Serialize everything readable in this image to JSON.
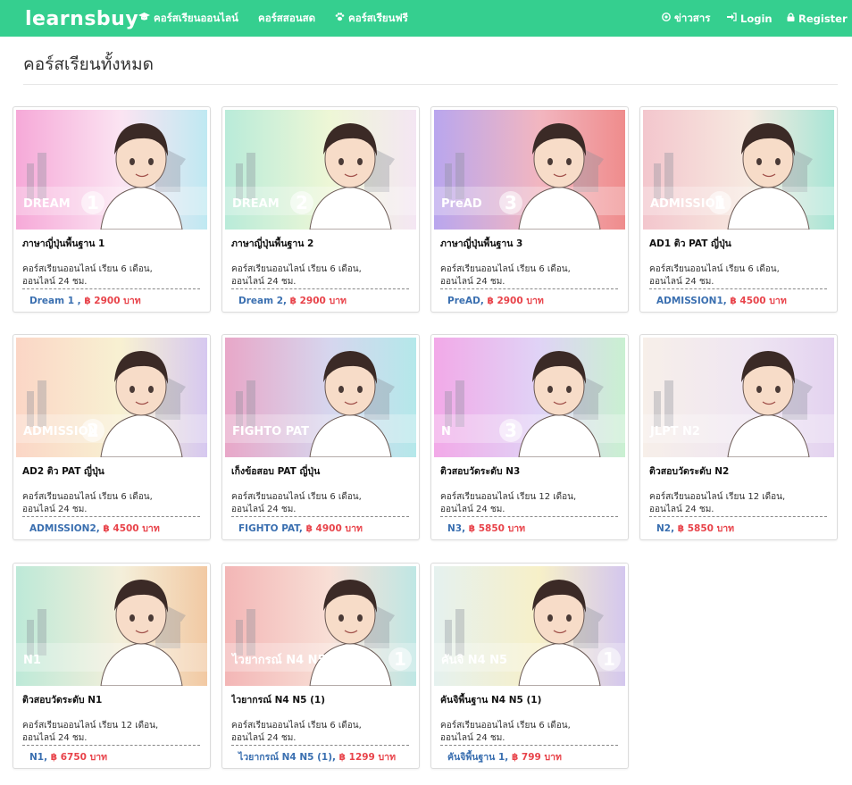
{
  "navbar": {
    "logo": "learnsbuy",
    "items": [
      {
        "label": "คอร์สเรียนออนไลน์",
        "icon": "graduation-cap-icon"
      },
      {
        "label": "คอร์สสอนสด",
        "icon": ""
      },
      {
        "label": "คอร์สเรียนฟรี",
        "icon": "paw-icon"
      }
    ],
    "right": [
      {
        "label": "ข่าวสาร",
        "icon": "news-icon"
      },
      {
        "label": "Login",
        "icon": "sign-in-icon"
      },
      {
        "label": "Register",
        "icon": "lock-icon"
      }
    ]
  },
  "page": {
    "title": "คอร์สเรียนทั้งหมด"
  },
  "courses": [
    {
      "title": "ภาษาญี่ปุ่นพื้นฐาน 1",
      "desc1": "คอร์สเรียนออนไลน์ เรียน 6 เดือน,",
      "desc2": "ออนไลน์ 24 ชม.",
      "code": "Dream 1 ,",
      "price": "฿ 2900 บาท",
      "badge": "DREAM",
      "num": "1",
      "colors": [
        "#f6a9d8",
        "#fbe4f2",
        "#bfe9f2"
      ]
    },
    {
      "title": "ภาษาญี่ปุ่นพื้นฐาน 2",
      "desc1": "คอร์สเรียนออนไลน์ เรียน 6 เดือน,",
      "desc2": "ออนไลน์ 24 ชม.",
      "code": "Dream 2,",
      "price": "฿ 2900 บาท",
      "badge": "DREAM",
      "num": "2",
      "colors": [
        "#b9ebd9",
        "#eef7d6",
        "#f4e6f3"
      ]
    },
    {
      "title": "ภาษาญี่ปุ่นพื้นฐาน 3",
      "desc1": "คอร์สเรียนออนไลน์ เรียน 6 เดือน,",
      "desc2": "ออนไลน์ 24 ชม.",
      "code": "PreAD,",
      "price": "฿ 2900 บาท",
      "badge": "PreAD",
      "num": "3",
      "colors": [
        "#b9a6ee",
        "#f2b6c0",
        "#ef8c8c"
      ]
    },
    {
      "title": "AD1 ติว PAT ญี่ปุ่น",
      "desc1": "คอร์สเรียนออนไลน์ เรียน 6 เดือน,",
      "desc2": "ออนไลน์ 24 ชม.",
      "code": "ADMISSION1,",
      "price": "฿ 4500 บาท",
      "badge": "ADMISSION",
      "num": "1",
      "colors": [
        "#f3c6cd",
        "#f7e9e0",
        "#a8e6d6"
      ]
    },
    {
      "title": "AD2 ติว PAT ญี่ปุ่น",
      "desc1": "คอร์สเรียนออนไลน์ เรียน 6 เดือน,",
      "desc2": "ออนไลน์ 24 ชม.",
      "code": "ADMISSION2,",
      "price": "฿ 4500 บาท",
      "badge": "ADMISSION",
      "num": "2",
      "colors": [
        "#fbd6c6",
        "#f8f1d2",
        "#d6c8f0"
      ]
    },
    {
      "title": "เก็งข้อสอบ PAT ญี่ปุ่น",
      "desc1": "คอร์สเรียนออนไลน์ เรียน 6 เดือน,",
      "desc2": "ออนไลน์ 24 ชม.",
      "code": "FIGHTO PAT,",
      "price": "฿ 4900 บาท",
      "badge": "FIGHTO PAT",
      "num": "",
      "colors": [
        "#e8a7c8",
        "#d6d6ee",
        "#b4e8ea"
      ]
    },
    {
      "title": "ติวสอบวัดระดับ N3",
      "desc1": "คอร์สเรียนออนไลน์ เรียน 12 เดือน,",
      "desc2": "ออนไลน์ 24 ชม.",
      "code": "N3,",
      "price": "฿ 5850 บาท",
      "badge": "N",
      "num": "3",
      "colors": [
        "#f2a9e8",
        "#e0d3f6",
        "#c9f0d1"
      ]
    },
    {
      "title": "ติวสอบวัดระดับ N2",
      "desc1": "คอร์สเรียนออนไลน์ เรียน 12 เดือน,",
      "desc2": "ออนไลน์ 24 ชม.",
      "code": "N2,",
      "price": "฿ 5850 บาท",
      "badge": "JLPT N2",
      "num": "",
      "colors": [
        "#f7efe9",
        "#efe6f2",
        "#e3d2f0"
      ]
    },
    {
      "title": "ติวสอบวัดระดับ N1",
      "desc1": "คอร์สเรียนออนไลน์ เรียน 12 เดือน,",
      "desc2": "ออนไลน์ 24 ชม.",
      "code": "N1,",
      "price": "฿ 6750 บาท",
      "badge": "N1",
      "num": "",
      "colors": [
        "#bde9d8",
        "#f4efda",
        "#f2c9a3"
      ]
    },
    {
      "title": "ไวยากรณ์ N4 N5 (1)",
      "desc1": "คอร์สเรียนออนไลน์ เรียน 6 เดือน,",
      "desc2": "ออนไลน์ 24 ชม.",
      "code": "ไวยากรณ์ N4 N5 (1),",
      "price": "฿ 1299 บาท",
      "badge": "ไวยากรณ์ N4 N5",
      "num": "1",
      "colors": [
        "#f3b6b6",
        "#f8dfd6",
        "#bfe7e4"
      ]
    },
    {
      "title": "คันจิพื้นฐาน N4 N5 (1)",
      "desc1": "คอร์สเรียนออนไลน์ เรียน 6 เดือน,",
      "desc2": "ออนไลน์ 24 ชม.",
      "code": "คันจิพื้นฐาน 1,",
      "price": "฿ 799 บาท",
      "badge": "คันจิ N4 N5",
      "num": "1",
      "colors": [
        "#e5f1ef",
        "#f7f0c8",
        "#d4c7ee"
      ]
    }
  ]
}
